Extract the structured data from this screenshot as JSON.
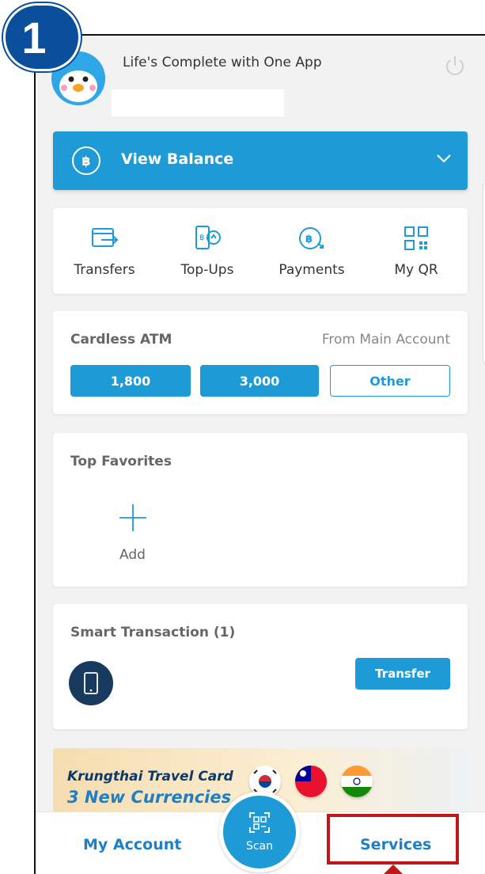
{
  "step": {
    "number": "1"
  },
  "header": {
    "tagline": "Life's Complete with One App"
  },
  "balance": {
    "label": "View Balance",
    "currency_symbol": "฿"
  },
  "quick_actions": [
    {
      "label": "Transfers",
      "icon": "transfer-icon"
    },
    {
      "label": "Top-Ups",
      "icon": "topup-icon"
    },
    {
      "label": "Payments",
      "icon": "payment-icon"
    },
    {
      "label": "My QR",
      "icon": "qr-icon"
    }
  ],
  "cardless": {
    "title": "Cardless ATM",
    "source": "From Main Account",
    "amounts": [
      "1,800",
      "3,000"
    ],
    "other_label": "Other"
  },
  "favorites": {
    "title": "Top Favorites",
    "add_label": "Add"
  },
  "smart": {
    "title": "Smart Transaction (1)",
    "button": "Transfer"
  },
  "promo": {
    "line1": "Krungthai Travel Card",
    "line2": "3 New Currencies"
  },
  "nav": {
    "account": "My Account",
    "scan": "Scan",
    "services": "Services"
  },
  "colors": {
    "brand_blue": "#1e9bd7",
    "badge_blue": "#0b4f9c",
    "highlight_red": "#c01818"
  }
}
